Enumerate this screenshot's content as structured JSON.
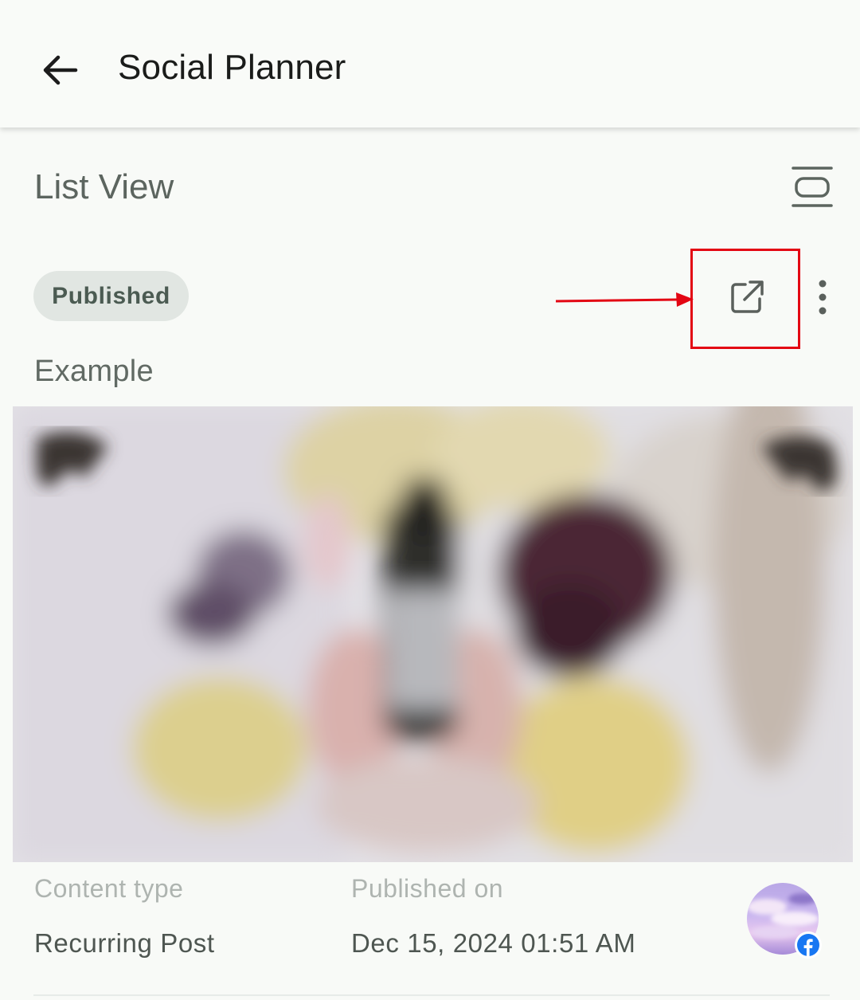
{
  "app_bar": {
    "title": "Social Planner",
    "back_icon": "arrow-left-icon"
  },
  "section": {
    "title": "List View",
    "view_toggle_icon": "view-agenda-icon"
  },
  "post": {
    "status": "Published",
    "title": "Example",
    "actions": {
      "open_link_icon": "open-in-new-icon",
      "more_icon": "more-vertical-icon"
    },
    "image": "blurred-flat-lay-product-photo",
    "meta": {
      "content_type_label": "Content type",
      "content_type_value": "Recurring Post",
      "published_on_label": "Published on",
      "published_on_value": "Dec 15, 2024 01:51 AM"
    },
    "platform": "facebook-icon"
  },
  "annotation": {
    "color": "#e30613"
  },
  "colors": {
    "background": "#f8faf7",
    "badge_background": "#e1e6e2",
    "badge_text": "#4b5b52",
    "facebook_blue": "#1877f2"
  }
}
